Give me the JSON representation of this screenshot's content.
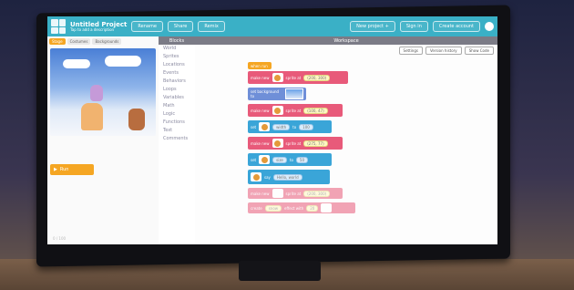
{
  "app": {
    "title": "Untitled Project",
    "subtitle": "Tap to add a description",
    "header_buttons": [
      "Rename",
      "Share",
      "Remix"
    ],
    "right_buttons": [
      "New project +",
      "Sign in",
      "Create account"
    ]
  },
  "stage": {
    "tabs": [
      "Stage",
      "Costumes",
      "Backgrounds"
    ],
    "play_label": "Run",
    "footer": "0 / 100"
  },
  "categories": {
    "header": "Blocks",
    "items": [
      "World",
      "Sprites",
      "Locations",
      "Events",
      "Behaviors",
      "Loops",
      "Variables",
      "Math",
      "Logic",
      "Functions",
      "Text",
      "Comments"
    ]
  },
  "workspace": {
    "header": "Workspace",
    "tools": [
      "Settings",
      "Version history",
      "Show Code"
    ],
    "blocks": [
      {
        "label": "when run"
      },
      {
        "label": "make new",
        "suffix": "sprite at",
        "value": "(200, 300)"
      },
      {
        "label": "set background to"
      },
      {
        "label": "make new",
        "suffix": "sprite at",
        "value": "(100, 47)"
      },
      {
        "label": "set",
        "mid": "width",
        "to": "to",
        "value": "100"
      },
      {
        "label": "make new",
        "suffix": "sprite at",
        "value": "(275, 77)"
      },
      {
        "label": "set",
        "mid": "size",
        "to": "to",
        "value": "50"
      },
      {
        "label": "say",
        "value": "Hello, world"
      },
      {
        "label": "make new",
        "suffix": "sprite at",
        "value": "(200, 300)"
      },
      {
        "label": "create",
        "mid": "snow",
        "suffix": "effect with",
        "value": "20"
      }
    ]
  },
  "colors": {
    "topbar": "#3ab0c6",
    "event_block": "#f5a623",
    "sprite_block": "#e85a7a",
    "background_block": "#6f8fd8",
    "motion_block": "#3aa5d8"
  }
}
